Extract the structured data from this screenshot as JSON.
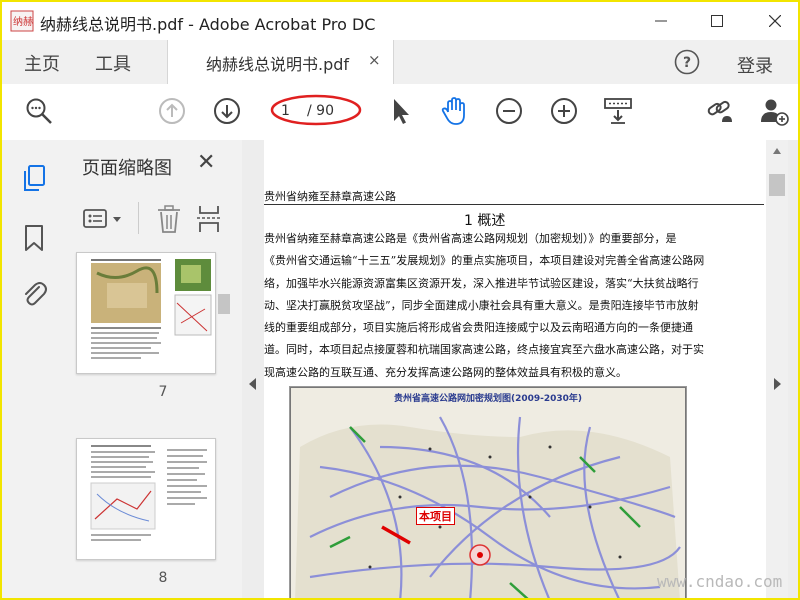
{
  "window": {
    "title": "纳赫线总说明书.pdf - Adobe Acrobat Pro DC",
    "app_icon_text": "纳赫"
  },
  "tabs": {
    "home": "主页",
    "tools": "工具",
    "document": "纳赫线总说明书.pdf",
    "document_close": "×",
    "help": "?",
    "login": "登录"
  },
  "toolbar": {
    "current_page": "1",
    "page_total": "/ 90"
  },
  "thumbnails": {
    "title": "页面缩略图",
    "close": "✕",
    "pages": [
      {
        "number": "7"
      },
      {
        "number": "8"
      }
    ]
  },
  "document": {
    "running_head": "贵州省纳雍至赫章高速公路",
    "section_heading": "1  概述",
    "paragraph_lines": [
      "    贵州省纳雍至赫章高速公路是《贵州省高速公路网规划（加密规划）》的重要部分，是",
      "《贵州省交通运输“十三五”发展规划》的重点实施项目，本项目建设对完善全省高速公路网",
      "络，加强毕水兴能源资源富集区资源开发，深入推进毕节试验区建设，落实“大扶贫战略行",
      "动、坚决打赢脱贫攻坚战”，同步全面建成小康社会具有重大意义。是贵阳连接毕节市放射",
      "线的重要组成部分，项目实施后将形成省会贵阳连接威宁以及云南昭通方向的一条便捷通",
      "道。同时，本项目起点接厦蓉和杭瑞国家高速公路，终点接宜宾至六盘水高速公路，对于实",
      "现高速公路的互联互通、充分发挥高速公路网的整体效益具有积极的意义。"
    ],
    "map_title": "贵州省高速公路网加密规划图(2009-2030年)",
    "map_project_label": "本项目"
  },
  "watermark": "www.cndao.com",
  "colors": {
    "window_border": "#f2e500",
    "accent_blue": "#1473e6",
    "annotation_red": "#e02020"
  }
}
